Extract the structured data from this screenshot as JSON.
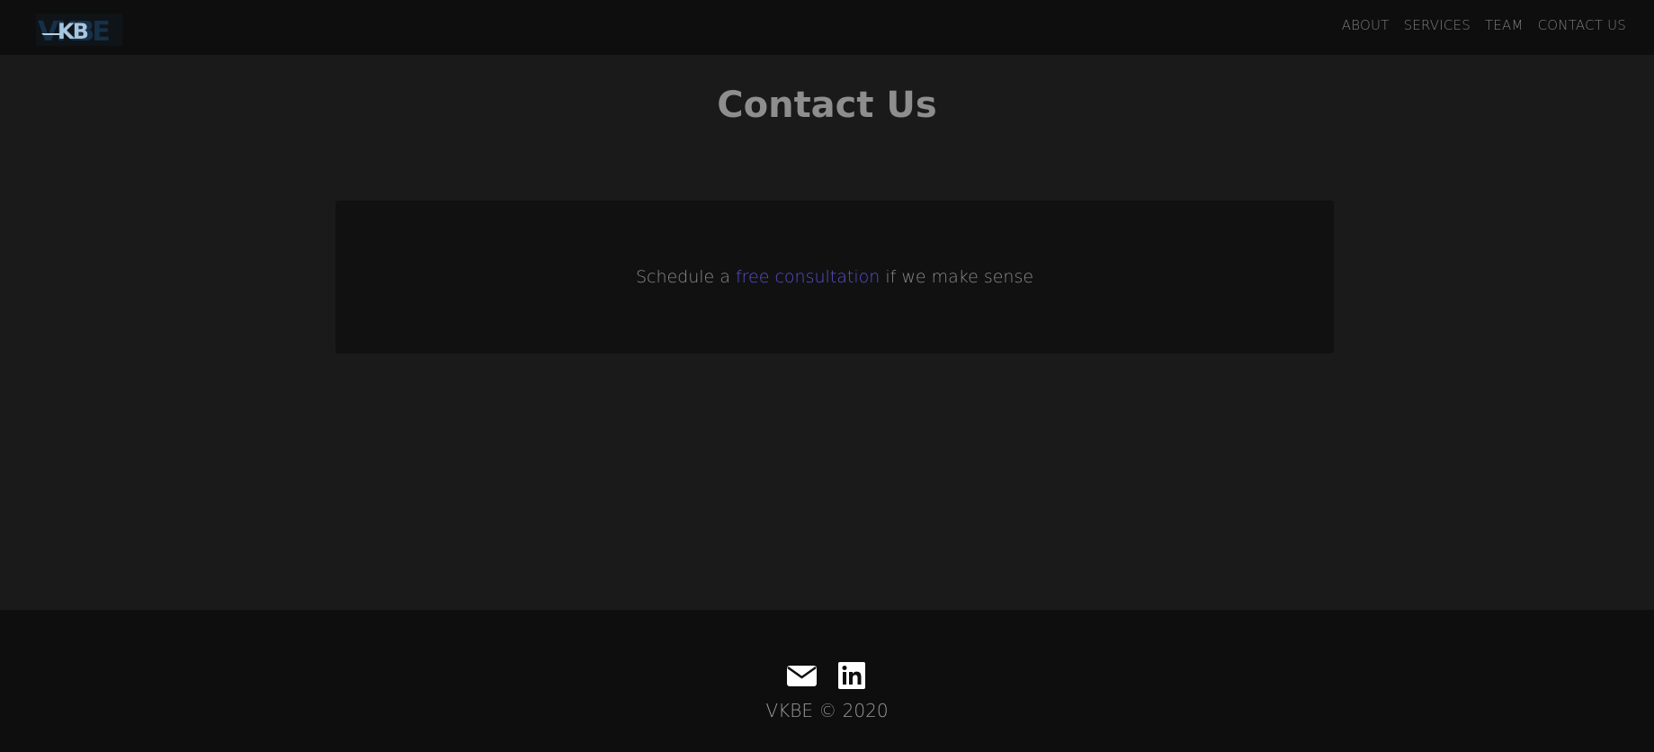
{
  "logo": {
    "text": "VKBE",
    "colors": [
      "#123a5e",
      "#a7c6dd"
    ]
  },
  "nav": {
    "items": [
      {
        "label": "ABOUT"
      },
      {
        "label": "SERVICES"
      },
      {
        "label": "TEAM"
      },
      {
        "label": "CONTACT US"
      }
    ]
  },
  "main": {
    "title": "Contact Us",
    "cta": {
      "prefix": "Schedule a ",
      "link_text": "free consultation",
      "suffix": " if we make sense"
    }
  },
  "footer": {
    "icons": [
      "envelope-icon",
      "linkedin-icon"
    ],
    "copyright": "VKBE © 2020"
  },
  "colors": {
    "page_background": "#1a1a1a",
    "nav_background": "#0e0e0e",
    "card_background": "#111111",
    "link": "#5a4fd0",
    "title": "#8e8e8e"
  }
}
